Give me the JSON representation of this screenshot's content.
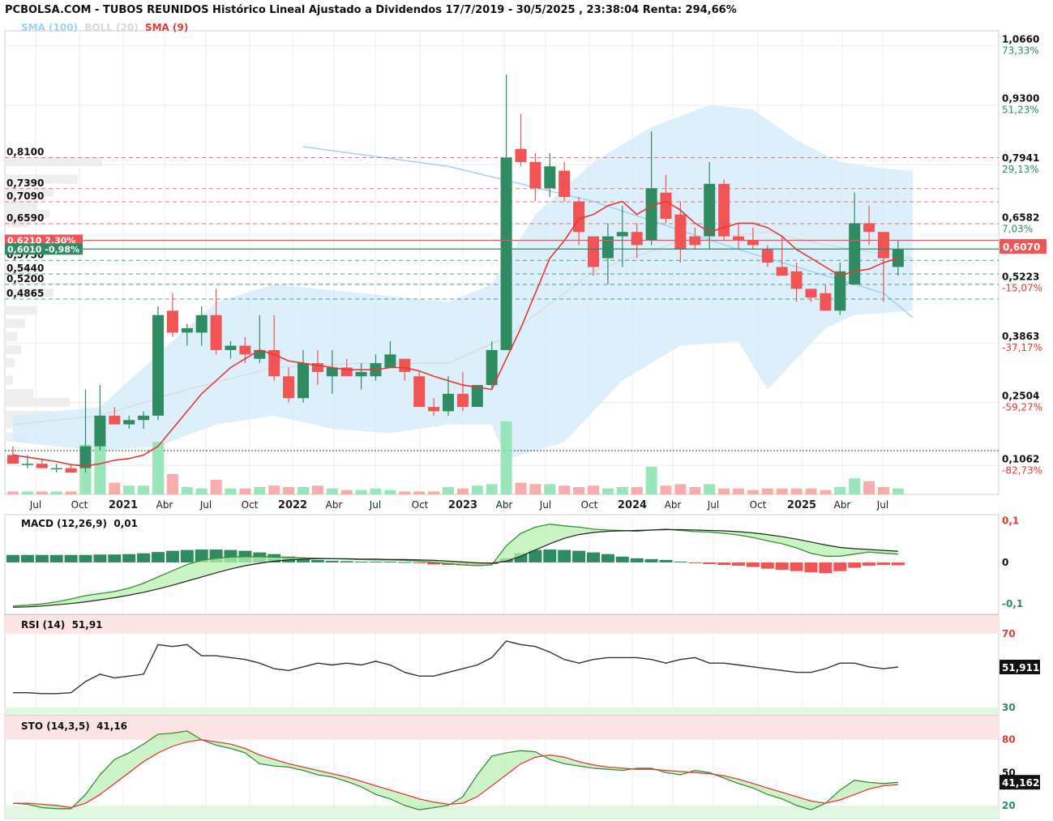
{
  "header": {
    "title": "PCBOLSA.COM - TUBOS REUNIDOS Histórico Lineal Ajustado a Dividendos 17/7/2019 - 30/5/2025 , 23:38:04 Renta: 294,66%",
    "indicators": [
      {
        "label": "SMA (100)",
        "color": "#9fd3f5"
      },
      {
        "label": "BOLL (20)",
        "color": "#d8d8d8"
      },
      {
        "label": "SMA (9)",
        "color": "#e53935"
      }
    ]
  },
  "colors": {
    "up": "#2e8b62",
    "down": "#f05454",
    "band_fill": "#d6ecfa",
    "sma100": "#9fd3f5",
    "sma9": "#e53935"
  },
  "chart_data": [
    {
      "id": "price",
      "type": "candlestick",
      "title": "TUBOS REUNIDOS",
      "x_ticks": [
        "Jul",
        "Oct",
        "2021",
        "Abr",
        "Jul",
        "Oct",
        "2022",
        "Abr",
        "Jul",
        "Oct",
        "2023",
        "Abr",
        "Jul",
        "Oct",
        "2024",
        "Abr",
        "Jul",
        "Oct",
        "2025",
        "Abr",
        "Jul"
      ],
      "y_ticks": [
        {
          "value": "1,0660",
          "pct": "73,33%"
        },
        {
          "value": "0,9300",
          "pct": "51,23%"
        },
        {
          "value": "0,7941",
          "pct": "29,13%"
        },
        {
          "value": "0,6582",
          "pct": "7,03%"
        },
        {
          "value": "0,5223",
          "pct": "-15,07%"
        },
        {
          "value": "0,3863",
          "pct": "-37,17%"
        },
        {
          "value": "0,2504",
          "pct": "-59,27%"
        },
        {
          "value": "0,1062",
          "pct": "-82,73%"
        }
      ],
      "last_price": "0,6070",
      "ylim": [
        0.04,
        1.1
      ],
      "levels": [
        {
          "label": "0,8100",
          "value": 0.81,
          "color": "#f05454"
        },
        {
          "label": "0,7390",
          "value": 0.739,
          "color": "#f05454"
        },
        {
          "label": "0,7090",
          "value": 0.709,
          "color": "#f05454"
        },
        {
          "label": "0,6590",
          "value": 0.659,
          "color": "#f05454"
        },
        {
          "label": "0,5750",
          "value": 0.575,
          "color": "#2e8b62"
        },
        {
          "label": "0,5440",
          "value": 0.544,
          "color": "#2e8b62"
        },
        {
          "label": "0,5200",
          "value": 0.52,
          "color": "#2e8b62"
        },
        {
          "label": "0,4865",
          "value": 0.4865,
          "color": "#2e8b62"
        }
      ],
      "badges": [
        {
          "text": "0,6210 2,30%",
          "value": 0.621,
          "color": "#f05454"
        },
        {
          "text": "0,6010 -0,98%",
          "value": 0.601,
          "color": "#2e8b62"
        }
      ],
      "reference_line": 0.14,
      "candles": [
        [
          0.13,
          0.15,
          0.11,
          0.11
        ],
        [
          0.11,
          0.13,
          0.1,
          0.11
        ],
        [
          0.11,
          0.12,
          0.1,
          0.1
        ],
        [
          0.1,
          0.11,
          0.09,
          0.1
        ],
        [
          0.1,
          0.11,
          0.09,
          0.09
        ],
        [
          0.1,
          0.28,
          0.09,
          0.15
        ],
        [
          0.15,
          0.29,
          0.14,
          0.22
        ],
        [
          0.22,
          0.24,
          0.2,
          0.2
        ],
        [
          0.2,
          0.22,
          0.19,
          0.21
        ],
        [
          0.21,
          0.23,
          0.19,
          0.22
        ],
        [
          0.22,
          0.47,
          0.21,
          0.45
        ],
        [
          0.46,
          0.5,
          0.4,
          0.41
        ],
        [
          0.41,
          0.43,
          0.38,
          0.42
        ],
        [
          0.41,
          0.47,
          0.38,
          0.45
        ],
        [
          0.45,
          0.51,
          0.36,
          0.37
        ],
        [
          0.37,
          0.39,
          0.35,
          0.38
        ],
        [
          0.38,
          0.4,
          0.34,
          0.36
        ],
        [
          0.35,
          0.45,
          0.34,
          0.37
        ],
        [
          0.37,
          0.45,
          0.3,
          0.31
        ],
        [
          0.31,
          0.33,
          0.25,
          0.26
        ],
        [
          0.26,
          0.37,
          0.25,
          0.34
        ],
        [
          0.34,
          0.37,
          0.29,
          0.32
        ],
        [
          0.31,
          0.37,
          0.27,
          0.33
        ],
        [
          0.33,
          0.35,
          0.32,
          0.31
        ],
        [
          0.31,
          0.34,
          0.28,
          0.32
        ],
        [
          0.31,
          0.36,
          0.3,
          0.34
        ],
        [
          0.33,
          0.39,
          0.33,
          0.36
        ],
        [
          0.35,
          0.35,
          0.3,
          0.32
        ],
        [
          0.31,
          0.32,
          0.25,
          0.24
        ],
        [
          0.24,
          0.26,
          0.22,
          0.23
        ],
        [
          0.23,
          0.31,
          0.22,
          0.27
        ],
        [
          0.27,
          0.32,
          0.23,
          0.24
        ],
        [
          0.24,
          0.29,
          0.24,
          0.29
        ],
        [
          0.29,
          0.39,
          0.28,
          0.37
        ],
        [
          0.37,
          1.0,
          0.37,
          0.81
        ],
        [
          0.83,
          0.91,
          0.79,
          0.8
        ],
        [
          0.8,
          0.82,
          0.71,
          0.74
        ],
        [
          0.74,
          0.82,
          0.72,
          0.79
        ],
        [
          0.78,
          0.8,
          0.71,
          0.72
        ],
        [
          0.71,
          0.72,
          0.61,
          0.64
        ],
        [
          0.63,
          0.63,
          0.54,
          0.56
        ],
        [
          0.58,
          0.66,
          0.52,
          0.63
        ],
        [
          0.63,
          0.7,
          0.56,
          0.64
        ],
        [
          0.64,
          0.66,
          0.58,
          0.61
        ],
        [
          0.62,
          0.87,
          0.61,
          0.74
        ],
        [
          0.73,
          0.77,
          0.66,
          0.67
        ],
        [
          0.68,
          0.71,
          0.57,
          0.6
        ],
        [
          0.63,
          0.65,
          0.6,
          0.61
        ],
        [
          0.63,
          0.8,
          0.6,
          0.75
        ],
        [
          0.75,
          0.76,
          0.62,
          0.63
        ],
        [
          0.63,
          0.66,
          0.6,
          0.62
        ],
        [
          0.62,
          0.65,
          0.6,
          0.61
        ],
        [
          0.6,
          0.61,
          0.56,
          0.57
        ],
        [
          0.56,
          0.63,
          0.54,
          0.54
        ],
        [
          0.55,
          0.57,
          0.48,
          0.51
        ],
        [
          0.51,
          0.51,
          0.48,
          0.49
        ],
        [
          0.5,
          0.52,
          0.46,
          0.46
        ],
        [
          0.46,
          0.57,
          0.45,
          0.55
        ],
        [
          0.52,
          0.73,
          0.52,
          0.66
        ],
        [
          0.66,
          0.7,
          0.61,
          0.64
        ],
        [
          0.64,
          0.64,
          0.48,
          0.58
        ],
        [
          0.56,
          0.62,
          0.54,
          0.6
        ]
      ],
      "sma9": [
        0.13,
        0.125,
        0.12,
        0.115,
        0.108,
        0.105,
        0.11,
        0.118,
        0.122,
        0.13,
        0.15,
        0.19,
        0.23,
        0.27,
        0.3,
        0.33,
        0.35,
        0.37,
        0.36,
        0.345,
        0.34,
        0.335,
        0.33,
        0.325,
        0.325,
        0.325,
        0.33,
        0.33,
        0.322,
        0.31,
        0.3,
        0.29,
        0.285,
        0.28,
        0.35,
        0.42,
        0.5,
        0.58,
        0.62,
        0.67,
        0.68,
        0.7,
        0.71,
        0.68,
        0.7,
        0.71,
        0.69,
        0.66,
        0.64,
        0.65,
        0.66,
        0.66,
        0.65,
        0.63,
        0.6,
        0.58,
        0.56,
        0.54,
        0.55,
        0.555,
        0.57,
        0.58
      ],
      "sma100": [
        [
          20,
          0.835
        ],
        [
          30,
          0.79
        ],
        [
          40,
          0.71
        ],
        [
          50,
          0.6
        ],
        [
          60,
          0.5
        ],
        [
          62,
          0.445
        ]
      ],
      "boll_mid": [
        [
          0,
          0.2
        ],
        [
          6,
          0.22
        ],
        [
          12,
          0.28
        ],
        [
          18,
          0.33
        ],
        [
          24,
          0.34
        ],
        [
          30,
          0.34
        ],
        [
          34,
          0.4
        ],
        [
          40,
          0.55
        ],
        [
          46,
          0.62
        ],
        [
          52,
          0.64
        ],
        [
          56,
          0.61
        ],
        [
          60,
          0.59
        ],
        [
          62,
          0.58
        ]
      ],
      "boll_upper": [
        [
          0,
          0.22
        ],
        [
          6,
          0.24
        ],
        [
          10,
          0.36
        ],
        [
          14,
          0.48
        ],
        [
          18,
          0.52
        ],
        [
          24,
          0.5
        ],
        [
          30,
          0.48
        ],
        [
          33,
          0.52
        ],
        [
          36,
          0.68
        ],
        [
          40,
          0.8
        ],
        [
          44,
          0.88
        ],
        [
          48,
          0.93
        ],
        [
          51,
          0.92
        ],
        [
          54,
          0.85
        ],
        [
          57,
          0.8
        ],
        [
          60,
          0.785
        ],
        [
          62,
          0.78
        ]
      ],
      "boll_lower": [
        [
          0,
          0.16
        ],
        [
          6,
          0.14
        ],
        [
          10,
          0.15
        ],
        [
          14,
          0.2
        ],
        [
          18,
          0.22
        ],
        [
          22,
          0.19
        ],
        [
          26,
          0.18
        ],
        [
          30,
          0.2
        ],
        [
          33,
          0.2
        ],
        [
          34,
          0.12
        ],
        [
          38,
          0.16
        ],
        [
          42,
          0.3
        ],
        [
          46,
          0.38
        ],
        [
          50,
          0.39
        ],
        [
          52,
          0.28
        ],
        [
          54,
          0.35
        ],
        [
          56,
          0.42
        ],
        [
          58,
          0.45
        ],
        [
          62,
          0.46
        ]
      ],
      "volume": [
        0.1,
        0.1,
        0.1,
        0.1,
        0.1,
        1.7,
        1.8,
        0.4,
        0.3,
        0.3,
        1.8,
        0.7,
        0.25,
        0.2,
        0.5,
        0.2,
        0.2,
        0.25,
        0.3,
        0.25,
        0.25,
        0.3,
        0.2,
        0.15,
        0.15,
        0.2,
        0.15,
        0.1,
        0.1,
        0.1,
        0.25,
        0.2,
        0.3,
        0.35,
        2.5,
        0.4,
        0.35,
        0.35,
        0.3,
        0.25,
        0.3,
        0.2,
        0.25,
        0.25,
        0.95,
        0.3,
        0.35,
        0.25,
        0.35,
        0.2,
        0.2,
        0.15,
        0.2,
        0.2,
        0.2,
        0.2,
        0.15,
        0.25,
        0.55,
        0.45,
        0.25,
        0.2
      ]
    },
    {
      "id": "macd",
      "type": "line",
      "title": "MACD (12,26,9)",
      "value": "0,01",
      "y_ticks": [
        {
          "label": "0,1",
          "value": 0.1,
          "color": "#e53935"
        },
        {
          "label": "0",
          "value": 0,
          "color": "#111"
        },
        {
          "label": "-0,1",
          "value": -0.1,
          "color": "#2e8b62"
        }
      ],
      "ylim": [
        -0.125,
        0.115
      ],
      "macd": [
        -0.105,
        -0.103,
        -0.1,
        -0.095,
        -0.088,
        -0.08,
        -0.075,
        -0.07,
        -0.062,
        -0.05,
        -0.035,
        -0.02,
        -0.005,
        0.005,
        0.01,
        0.013,
        0.014,
        0.014,
        0.013,
        0.012,
        0.011,
        0.01,
        0.009,
        0.008,
        0.007,
        0.006,
        0.006,
        0.005,
        0.003,
        0.0,
        -0.003,
        -0.006,
        -0.008,
        -0.006,
        0.04,
        0.07,
        0.085,
        0.092,
        0.088,
        0.085,
        0.08,
        0.078,
        0.077,
        0.075,
        0.078,
        0.08,
        0.077,
        0.074,
        0.073,
        0.07,
        0.066,
        0.06,
        0.052,
        0.045,
        0.035,
        0.022,
        0.015,
        0.015,
        0.02,
        0.025,
        0.022,
        0.02
      ],
      "signal": [
        -0.108,
        -0.107,
        -0.105,
        -0.102,
        -0.099,
        -0.095,
        -0.09,
        -0.085,
        -0.079,
        -0.072,
        -0.064,
        -0.055,
        -0.045,
        -0.035,
        -0.025,
        -0.016,
        -0.008,
        -0.002,
        0.003,
        0.006,
        0.008,
        0.009,
        0.009,
        0.009,
        0.008,
        0.008,
        0.007,
        0.007,
        0.006,
        0.005,
        0.003,
        0.001,
        -0.001,
        -0.002,
        0.003,
        0.015,
        0.03,
        0.045,
        0.058,
        0.067,
        0.072,
        0.075,
        0.076,
        0.077,
        0.078,
        0.079,
        0.079,
        0.078,
        0.077,
        0.076,
        0.074,
        0.071,
        0.067,
        0.062,
        0.056,
        0.049,
        0.042,
        0.036,
        0.033,
        0.031,
        0.029,
        0.027
      ],
      "histogram": [
        0.018,
        0.018,
        0.018,
        0.018,
        0.018,
        0.018,
        0.019,
        0.019,
        0.02,
        0.022,
        0.025,
        0.028,
        0.03,
        0.031,
        0.031,
        0.03,
        0.028,
        0.024,
        0.02,
        0.014,
        0.01,
        0.006,
        0.004,
        0.003,
        0.002,
        0.002,
        0.002,
        0.001,
        -0.002,
        -0.005,
        -0.006,
        -0.007,
        -0.007,
        -0.004,
        0.01,
        0.022,
        0.03,
        0.031,
        0.03,
        0.028,
        0.024,
        0.02,
        0.014,
        0.01,
        0.008,
        0.006,
        0.002,
        -0.002,
        -0.004,
        -0.006,
        -0.008,
        -0.011,
        -0.015,
        -0.018,
        -0.021,
        -0.024,
        -0.026,
        -0.021,
        -0.013,
        -0.008,
        -0.006,
        -0.007
      ]
    },
    {
      "id": "rsi",
      "type": "line",
      "title": "RSI (14)",
      "value": "51,91",
      "last_label": "51,911",
      "y_ticks": [
        {
          "label": "70",
          "value": 70,
          "color": "#e53935"
        },
        {
          "label": "30",
          "value": 30,
          "color": "#2e8b62"
        }
      ],
      "ylim": [
        26,
        80
      ],
      "values": [
        38,
        38,
        37.5,
        37.5,
        38,
        44,
        48,
        46,
        47,
        48,
        64,
        63,
        64,
        58,
        58,
        57,
        56,
        54,
        51,
        50,
        52,
        54,
        53,
        54,
        53,
        55,
        53,
        49,
        47,
        47,
        49,
        51,
        53,
        57,
        66,
        64,
        63,
        60,
        56,
        54,
        56,
        57,
        57,
        57,
        56,
        54,
        56,
        57,
        54,
        54,
        53,
        52,
        51,
        50,
        49,
        49,
        51,
        54,
        54,
        52,
        51,
        51.91
      ]
    },
    {
      "id": "sto",
      "type": "line",
      "title": "STO (14,3,5)",
      "value": "41,16",
      "last_label": "41,162",
      "y_ticks": [
        {
          "label": "80",
          "value": 80,
          "color": "#e53935"
        },
        {
          "label": "50",
          "value": 50,
          "color": "#111"
        },
        {
          "label": "20",
          "value": 20,
          "color": "#2e8b62"
        }
      ],
      "ylim": [
        8,
        102
      ],
      "k": [
        22,
        21,
        18,
        17,
        17,
        30,
        48,
        62,
        68,
        76,
        85,
        86,
        88,
        80,
        75,
        72,
        68,
        58,
        56,
        55,
        52,
        48,
        46,
        42,
        37,
        30,
        26,
        20,
        16,
        18,
        20,
        28,
        48,
        65,
        68,
        70,
        69,
        62,
        58,
        56,
        54,
        53,
        52,
        54,
        54,
        50,
        48,
        52,
        50,
        45,
        40,
        36,
        30,
        26,
        20,
        16,
        22,
        34,
        43,
        41,
        40,
        41.16
      ],
      "d": [
        22,
        22,
        21,
        20,
        18,
        22,
        30,
        40,
        50,
        60,
        68,
        74,
        78,
        80,
        78,
        76,
        72,
        66,
        62,
        58,
        55,
        52,
        49,
        46,
        42,
        38,
        34,
        30,
        26,
        23,
        21,
        22,
        28,
        38,
        48,
        58,
        64,
        66,
        64,
        60,
        57,
        55,
        54,
        53,
        53,
        52,
        51,
        50,
        49,
        47,
        44,
        40,
        36,
        32,
        28,
        24,
        22,
        25,
        30,
        35,
        38,
        39
      ]
    }
  ]
}
